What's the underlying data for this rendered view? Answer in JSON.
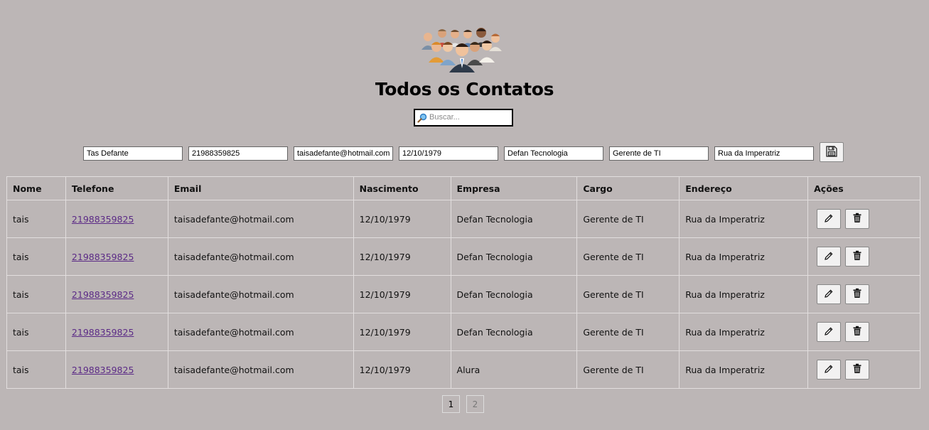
{
  "header": {
    "title": "Todos os Contatos",
    "logo_icon": "people-group-icon"
  },
  "search": {
    "placeholder": "Buscar...",
    "value": "",
    "icon": "search-icon"
  },
  "form": {
    "nome": "Tas Defante",
    "telefone": "21988359825",
    "email": "taisadefante@hotmail.com",
    "nascimento": "12/10/1979",
    "empresa": "Defan Tecnologia",
    "cargo": "Gerente de TI",
    "endereco": "Rua da Imperatriz",
    "save_icon": "floppy-disk-icon"
  },
  "table": {
    "headers": [
      "Nome",
      "Telefone",
      "Email",
      "Nascimento",
      "Empresa",
      "Cargo",
      "Endereço",
      "Ações"
    ],
    "rows": [
      {
        "nome": "tais",
        "telefone": "21988359825",
        "email": "taisadefante@hotmail.com",
        "nascimento": "12/10/1979",
        "empresa": "Defan Tecnologia",
        "cargo": "Gerente de TI",
        "endereco": "Rua da Imperatriz"
      },
      {
        "nome": "tais",
        "telefone": "21988359825",
        "email": "taisadefante@hotmail.com",
        "nascimento": "12/10/1979",
        "empresa": "Defan Tecnologia",
        "cargo": "Gerente de TI",
        "endereco": "Rua da Imperatriz"
      },
      {
        "nome": "tais",
        "telefone": "21988359825",
        "email": "taisadefante@hotmail.com",
        "nascimento": "12/10/1979",
        "empresa": "Defan Tecnologia",
        "cargo": "Gerente de TI",
        "endereco": "Rua da Imperatriz"
      },
      {
        "nome": "tais",
        "telefone": "21988359825",
        "email": "taisadefante@hotmail.com",
        "nascimento": "12/10/1979",
        "empresa": "Defan Tecnologia",
        "cargo": "Gerente de TI",
        "endereco": "Rua da Imperatriz"
      },
      {
        "nome": "tais",
        "telefone": "21988359825",
        "email": "taisadefante@hotmail.com",
        "nascimento": "12/10/1979",
        "empresa": "Alura",
        "cargo": "Gerente de TI",
        "endereco": "Rua da Imperatriz"
      }
    ],
    "action_icons": [
      "pencil-icon",
      "trash-icon"
    ]
  },
  "pagination": {
    "pages": [
      "1",
      "2"
    ],
    "current": "1"
  },
  "colors": {
    "background": "#bcb6b6",
    "link": "#5b2a86",
    "button_bg": "#f2f1f1"
  }
}
